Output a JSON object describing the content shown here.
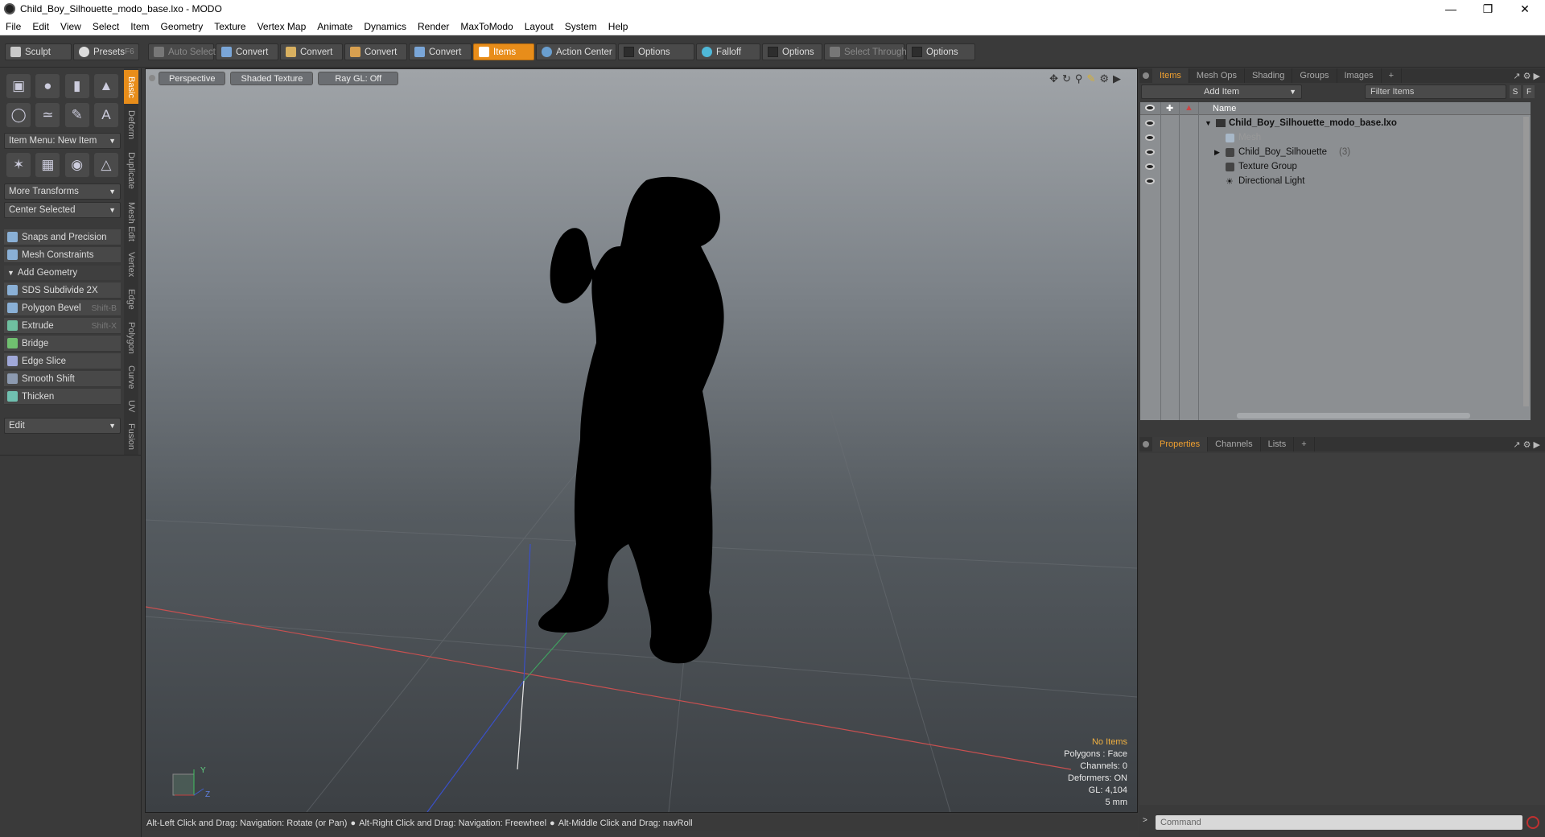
{
  "window": {
    "title": "Child_Boy_Silhouette_modo_base.lxo - MODO"
  },
  "menu": [
    "File",
    "Edit",
    "View",
    "Select",
    "Item",
    "Geometry",
    "Texture",
    "Vertex Map",
    "Animate",
    "Dynamics",
    "Render",
    "MaxToModo",
    "Layout",
    "System",
    "Help"
  ],
  "toolbar": {
    "sculpt": "Sculpt",
    "presets": "Presets",
    "presets_shortcut": "F6",
    "auto_select": "Auto Select",
    "convert1": "Convert",
    "convert2": "Convert",
    "convert3": "Convert",
    "convert4": "Convert",
    "items": "Items",
    "action_center": "Action Center",
    "options1": "Options",
    "falloff": "Falloff",
    "options2": "Options",
    "select_through": "Select Through",
    "options3": "Options"
  },
  "left": {
    "item_menu": "Item Menu: New Item",
    "more_transforms": "More Transforms",
    "center_selected": "Center Selected",
    "snaps": "Snaps and Precision",
    "mesh_constraints": "Mesh Constraints",
    "add_geometry": "Add Geometry",
    "tools": [
      {
        "label": "SDS Subdivide 2X",
        "shortcut": ""
      },
      {
        "label": "Polygon Bevel",
        "shortcut": "Shift-B"
      },
      {
        "label": "Extrude",
        "shortcut": "Shift-X"
      },
      {
        "label": "Bridge",
        "shortcut": ""
      },
      {
        "label": "Edge Slice",
        "shortcut": ""
      },
      {
        "label": "Smooth Shift",
        "shortcut": ""
      },
      {
        "label": "Thicken",
        "shortcut": ""
      }
    ],
    "edit_dropdown": "Edit",
    "vtabs": [
      "Basic",
      "Deform",
      "Duplicate",
      "Mesh Edit",
      "Vertex",
      "Edge",
      "Polygon",
      "Curve",
      "UV",
      "Fusion"
    ]
  },
  "viewport": {
    "tabs": [
      "Perspective",
      "Shaded Texture",
      "Ray GL: Off"
    ],
    "info": {
      "no_items": "No Items",
      "polygons": "Polygons : Face",
      "channels": "Channels: 0",
      "deformers": "Deformers: ON",
      "gl": "GL: 4,104",
      "scale": "5 mm"
    },
    "axis_y": "Y",
    "axis_z": "Z"
  },
  "status": {
    "hint1": "Alt-Left Click and Drag: Navigation: Rotate (or Pan)",
    "hint2": "Alt-Right Click and Drag: Navigation: Freewheel",
    "hint3": "Alt-Middle Click and Drag: navRoll"
  },
  "right": {
    "top_tabs": [
      "Items",
      "Mesh Ops",
      "Shading",
      "Groups",
      "Images"
    ],
    "add_item": "Add Item",
    "filter_items": "Filter Items",
    "filter_s": "S",
    "filter_f": "F",
    "col_name": "Name",
    "tree": [
      {
        "label": "Child_Boy_Silhouette_modo_base.lxo",
        "count": "",
        "indent": 0
      },
      {
        "label": "Mesh",
        "count": "",
        "indent": 1
      },
      {
        "label": "Child_Boy_Silhouette",
        "count": "(3)",
        "indent": 1
      },
      {
        "label": "Texture Group",
        "count": "",
        "indent": 1
      },
      {
        "label": "Directional Light",
        "count": "",
        "indent": 1
      }
    ],
    "bottom_tabs": [
      "Properties",
      "Channels",
      "Lists"
    ],
    "command_placeholder": "Command"
  }
}
